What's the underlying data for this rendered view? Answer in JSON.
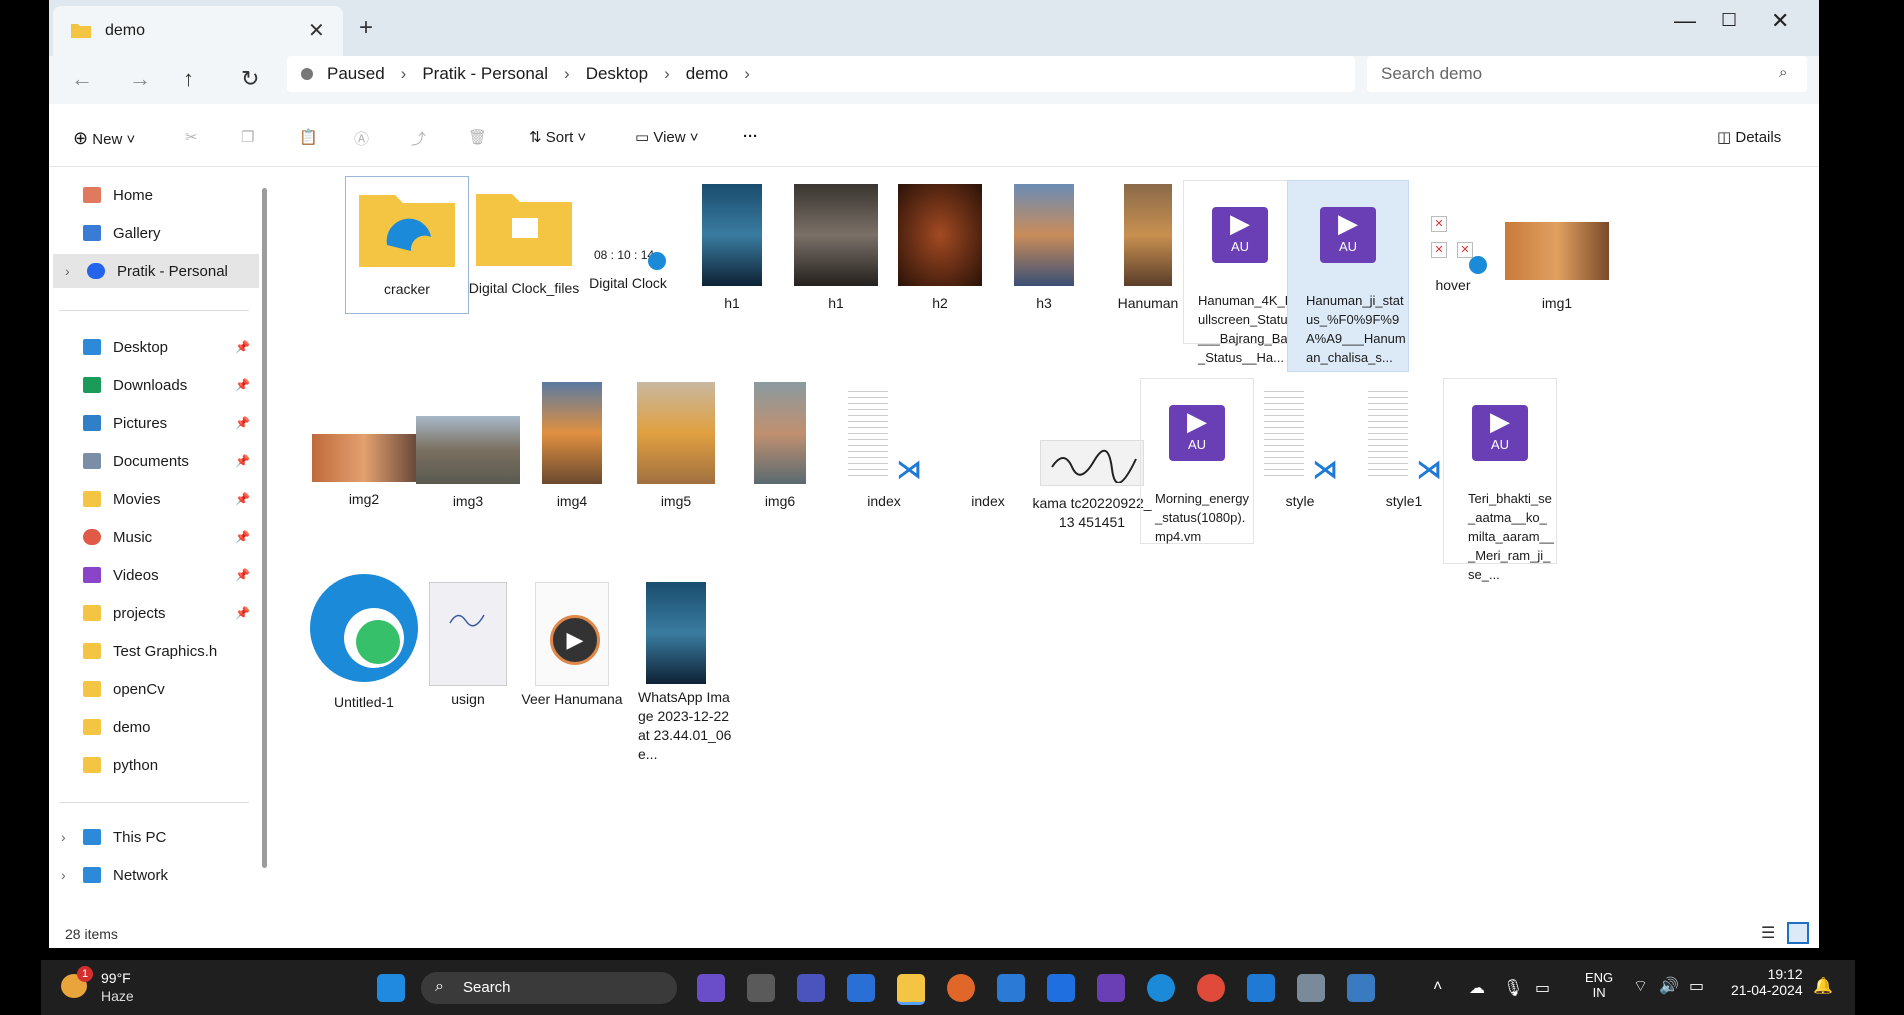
{
  "window": {
    "tab_title": "demo",
    "path": [
      "Paused",
      "Pratik - Personal",
      "Desktop",
      "demo"
    ],
    "search_placeholder": "Search demo"
  },
  "toolbar": {
    "new_label": "New",
    "sort_label": "Sort",
    "view_label": "View",
    "more_label": "···",
    "details_label": "Details"
  },
  "sidebar": {
    "top": [
      "Home",
      "Gallery",
      "Pratik - Personal"
    ],
    "quick": [
      "Desktop",
      "Downloads",
      "Pictures",
      "Documents",
      "Movies",
      "Music",
      "Videos",
      "projects",
      "Test Graphics.h",
      "openCv",
      "demo",
      "python"
    ],
    "bottom": [
      "This PC",
      "Network"
    ]
  },
  "files": [
    "cracker",
    "Digital Clock_files",
    "Digital Clock",
    "h1",
    "h1",
    "h2",
    "h3",
    "Hanuman",
    "Hanuman_4K_Fullscreen_Status___Bajrang_Bali_Status__Ha...",
    "Hanuman_ji_status_%F0%9F%9A%A9___Hanuman_chalisa_s...",
    "hover",
    "img1",
    "img2",
    "img3",
    "img4",
    "img5",
    "img6",
    "index",
    "index",
    "kama tc20220922_13 451451",
    "Morning_energy_status(1080p).mp4.vm",
    "style",
    "style1",
    "Teri_bhakti_se_aatma__ko_milta_aaram___Meri_ram_ji_se_...",
    "Untitled-1",
    "usign",
    "Veer Hanumana",
    "WhatsApp Image 2023-12-22 at 23.44.01_06e..."
  ],
  "clock_preview": "08 : 10 : 14",
  "au_badge": "AU",
  "status": {
    "item_count": "28 items"
  },
  "taskbar": {
    "weather_temp": "99°F",
    "weather_desc": "Haze",
    "notification_count": "1",
    "search_label": "Search",
    "lang_line1": "ENG",
    "lang_line2": "IN",
    "time": "19:12",
    "date": "21-04-2024"
  }
}
